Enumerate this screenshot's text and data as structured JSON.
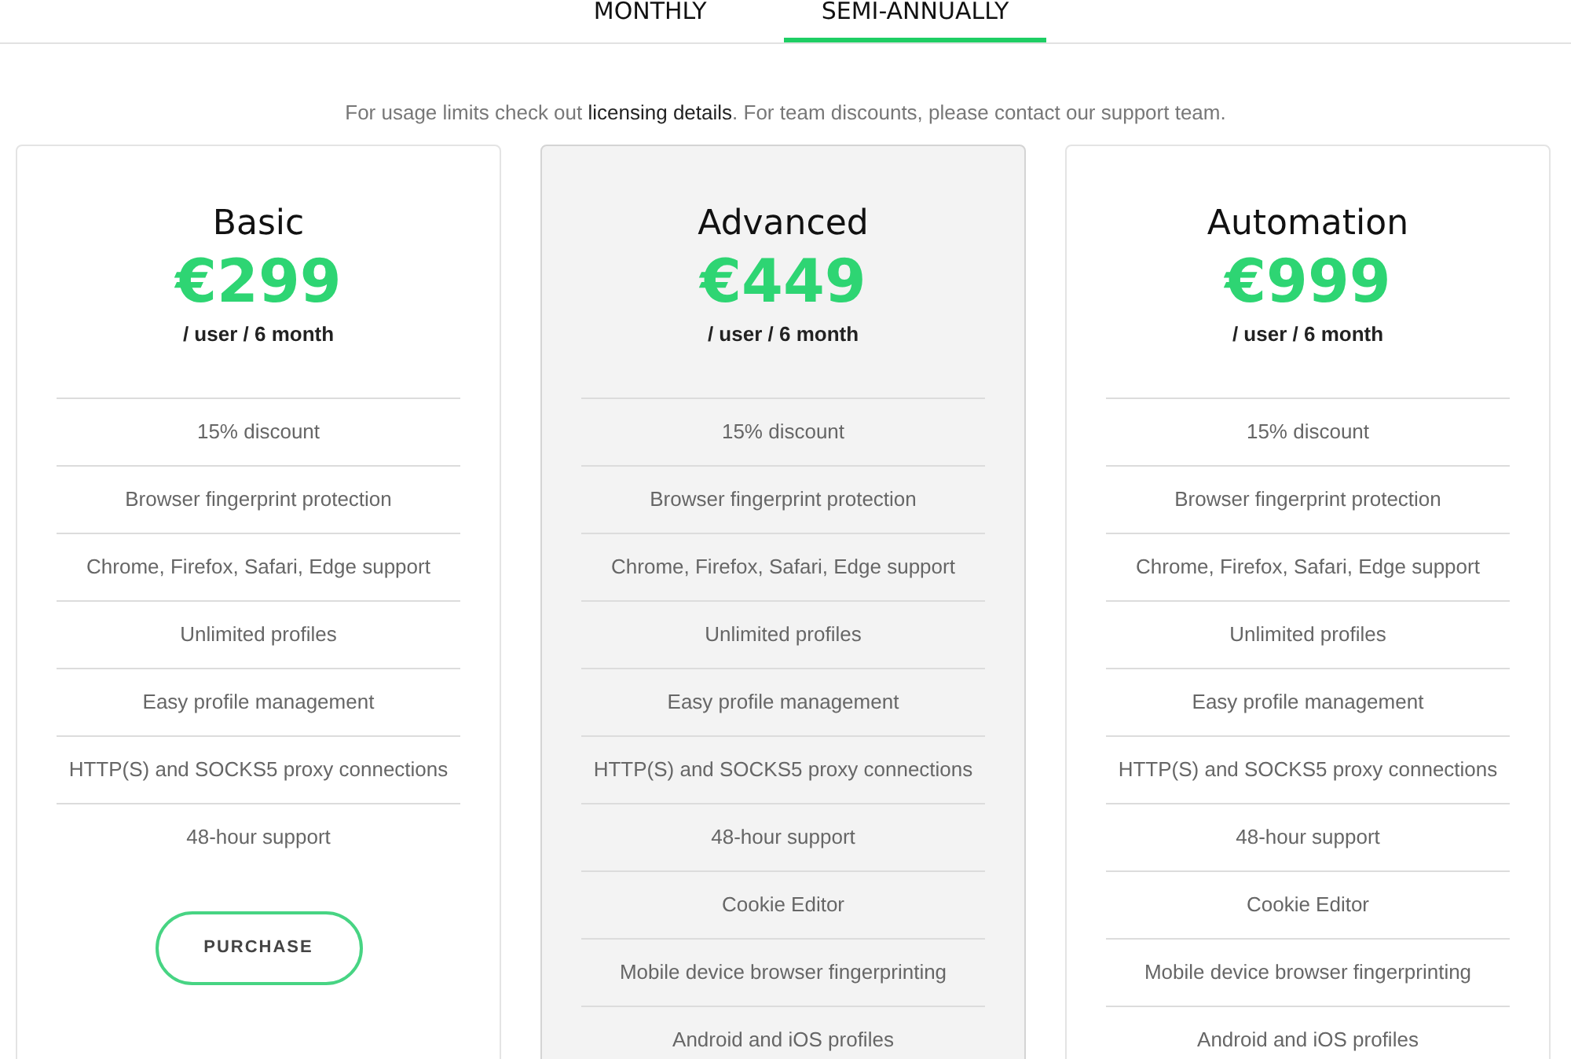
{
  "tabs": [
    {
      "label": "MONTHLY",
      "selected": false
    },
    {
      "label": "SEMI-ANNUALLY",
      "selected": true
    }
  ],
  "notice": {
    "before": "For usage limits check out ",
    "link": "licensing details",
    "after": ". For team discounts, please contact our support team."
  },
  "plans": [
    {
      "name": "Basic",
      "price": "€299",
      "period": "/ user / 6 month",
      "featured": false,
      "features": [
        "15% discount",
        "Browser fingerprint protection",
        "Chrome, Firefox, Safari, Edge support",
        "Unlimited profiles",
        "Easy profile management",
        "HTTP(S) and SOCKS5 proxy connections",
        "48-hour support"
      ],
      "button": "PURCHASE"
    },
    {
      "name": "Advanced",
      "price": "€449",
      "period": "/ user / 6 month",
      "featured": true,
      "features": [
        "15% discount",
        "Browser fingerprint protection",
        "Chrome, Firefox, Safari, Edge support",
        "Unlimited profiles",
        "Easy profile management",
        "HTTP(S) and SOCKS5 proxy connections",
        "48-hour support",
        "Cookie Editor",
        "Mobile device browser fingerprinting",
        "Android and iOS profiles"
      ]
    },
    {
      "name": "Automation",
      "price": "€999",
      "period": "/ user / 6 month",
      "featured": false,
      "features": [
        "15% discount",
        "Browser fingerprint protection",
        "Chrome, Firefox, Safari, Edge support",
        "Unlimited profiles",
        "Easy profile management",
        "HTTP(S) and SOCKS5 proxy connections",
        "48-hour support",
        "Cookie Editor",
        "Mobile device browser fingerprinting",
        "Android and iOS profiles"
      ]
    }
  ]
}
